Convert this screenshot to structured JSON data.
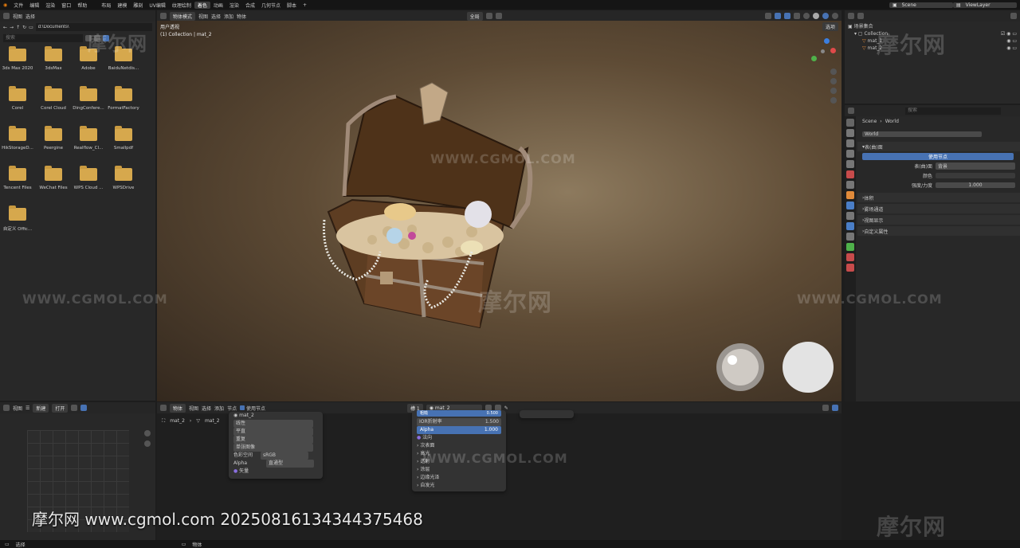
{
  "menu": {
    "items": [
      "文件",
      "编辑",
      "渲染",
      "窗口",
      "帮助"
    ],
    "workspace_tabs": [
      "布局",
      "建模",
      "雕刻",
      "UV编辑",
      "纹理绘制",
      "着色",
      "动画",
      "渲染",
      "合成",
      "几何节点",
      "脚本"
    ],
    "active_tab": "着色",
    "add_tab": "+"
  },
  "top_right": {
    "scene_label": "Scene",
    "viewlayer_label": "ViewLayer"
  },
  "file_browser": {
    "menu": [
      "视图",
      "选择"
    ],
    "path": "d:\\Documents\\",
    "search_placeholder": "搜索",
    "folders": [
      "3ds Max 2020",
      "3dsMax",
      "Adobe",
      "BaiduNetdis...",
      "Corel",
      "Corel Cloud",
      "DingConfere...",
      "FormatFactory",
      "HikStorageD...",
      "Peergine",
      "Realflow_Cl...",
      "Smallpdf",
      "Tencent Files",
      "WeChat Files",
      "WPS Cloud ...",
      "WPSDrive",
      "自定义 Offic..."
    ]
  },
  "viewport": {
    "mode": "物体模式",
    "menus": [
      "视图",
      "选择",
      "添加",
      "物体"
    ],
    "transform": "全局",
    "overlay_label": "用户透视",
    "collection_label": "(1) Collection | mat_2",
    "options_btn": "选项"
  },
  "outliner": {
    "title": "场景集合",
    "items": [
      "Collection",
      "mat_1",
      "mat_2"
    ]
  },
  "properties": {
    "search_placeholder": "搜索",
    "breadcrumb_scene": "Scene",
    "breadcrumb_world": "World",
    "world_name": "World",
    "surface_title": "表(曲)面",
    "use_nodes": "使用节点",
    "surface_label": "表(曲)面",
    "surface_value": "背景",
    "color_label": "颜色",
    "strength_label": "强度/力度",
    "strength_value": "1.000",
    "sections": [
      "体积",
      "雾场通道",
      "视图显示",
      "自定义属性"
    ]
  },
  "image_editor": {
    "menu": [
      "视图"
    ],
    "new_btn": "新建",
    "open_btn": "打开"
  },
  "node_editor": {
    "object_label": "物体",
    "menus": [
      "视图",
      "选择",
      "添加",
      "节点"
    ],
    "use_nodes": "使用节点",
    "slot": "槽 1",
    "material": "mat_2",
    "crumb_obj": "mat_2",
    "crumb_mat": "mat_2"
  },
  "image_node": {
    "title": "mat_2",
    "rows": [
      "线性",
      "平直",
      "重复",
      "单张图像"
    ],
    "colorspace_label": "色彩空间",
    "colorspace_value": "sRGB",
    "alpha_label": "Alpha",
    "alpha_value": "直通型",
    "vector": "矢量"
  },
  "bsdf_node": {
    "row1_label": "粗糙",
    "row1_value": "0.500",
    "ior_label": "IOR折射率",
    "ior_value": "1.500",
    "alpha_label": "Alpha",
    "alpha_value": "1.000",
    "normal": "法向",
    "sections": [
      "次表面",
      "高光",
      "透射",
      "涂层",
      "边缘光泽",
      "自发光"
    ]
  },
  "status": {
    "left": "选择",
    "mid": "物体"
  },
  "watermark": {
    "caption": "摩尔网 www.cgmol.com 20250816134344375468",
    "url": "WWW.CGMOL.COM",
    "brand": "摩尔网"
  },
  "colors": {
    "accent": "#4772b3",
    "folder": "#d6a84d",
    "bg": "#1d1d1d",
    "panel": "#282828"
  }
}
